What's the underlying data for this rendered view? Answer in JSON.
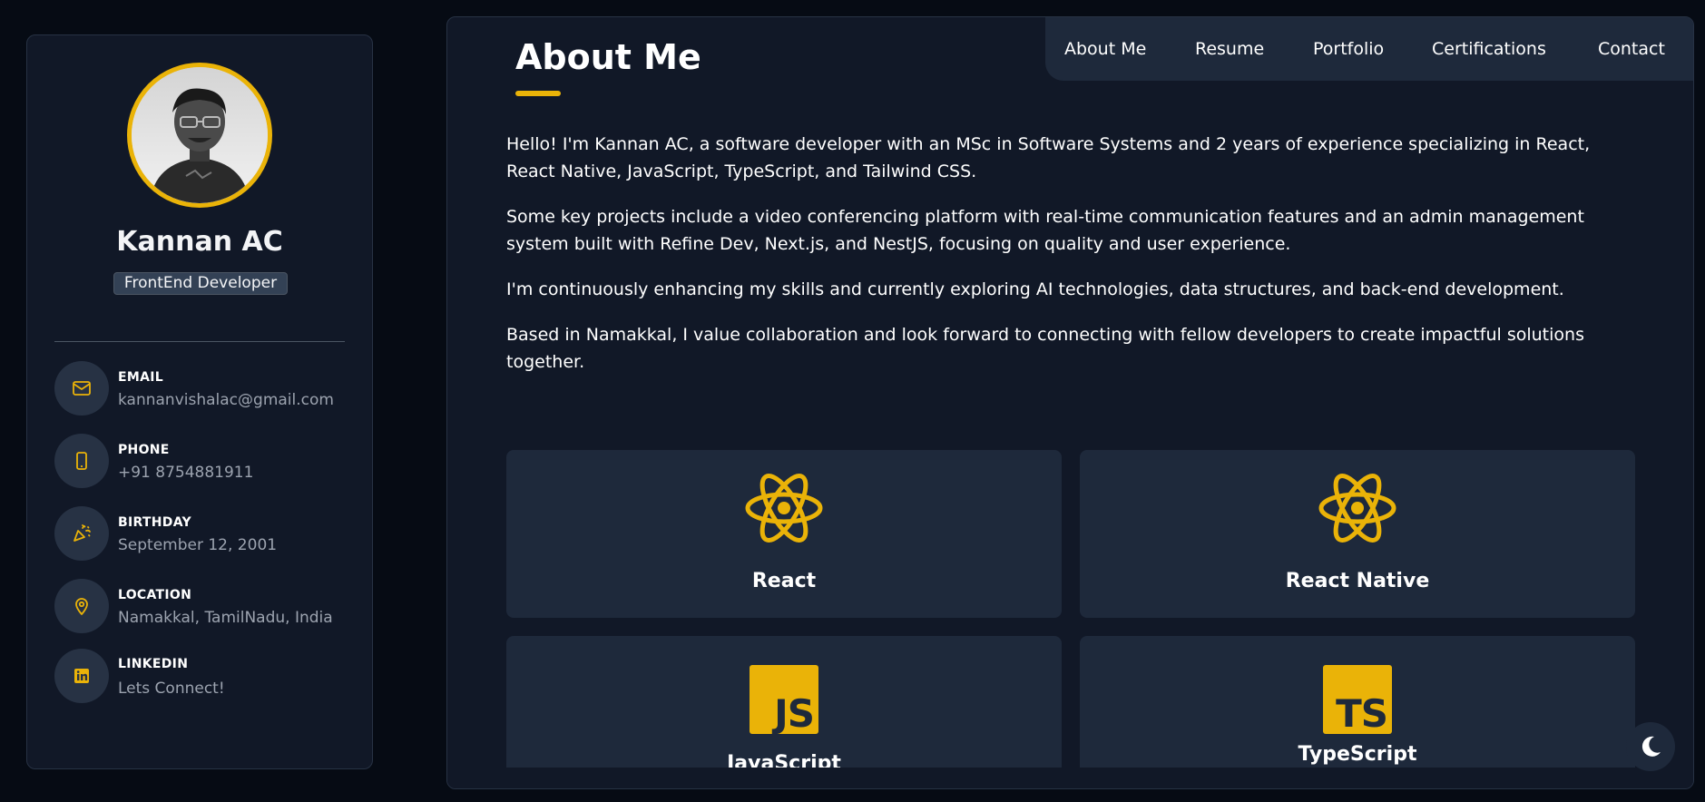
{
  "profile": {
    "name": "Kannan AC",
    "role": "FrontEnd Developer"
  },
  "contacts": [
    {
      "label": "EMAIL",
      "value": "kannanvishalac@gmail.com",
      "icon": "mail-icon"
    },
    {
      "label": "PHONE",
      "value": "+91 8754881911",
      "icon": "phone-icon"
    },
    {
      "label": "BIRTHDAY",
      "value": "September 12, 2001",
      "icon": "party-popper-icon"
    },
    {
      "label": "LOCATION",
      "value": "Namakkal, TamilNadu, India",
      "icon": "map-pin-icon"
    },
    {
      "label": "LINKEDIN",
      "value": "Lets Connect!",
      "icon": "linkedin-icon"
    }
  ],
  "nav": {
    "items": [
      "About Me",
      "Resume",
      "Portfolio",
      "Certifications",
      "Contact"
    ]
  },
  "about": {
    "title": "About Me",
    "paragraphs": [
      "Hello! I'm Kannan AC, a software developer with an MSc in Software Systems and 2 years of experience specializing in React, React Native, JavaScript, TypeScript, and Tailwind CSS.",
      "Some key projects include a video conferencing platform with real-time communication features and an admin management system built with Refine Dev, Next.js, and NestJS, focusing on quality and user experience.",
      "I'm continuously enhancing my skills and currently exploring AI technologies, data structures, and back-end development.",
      "Based in Namakkal, I value collaboration and look forward to connecting with fellow developers to create impactful solutions together."
    ]
  },
  "skills": [
    {
      "name": "React",
      "icon": "react-icon"
    },
    {
      "name": "React Native",
      "icon": "react-icon"
    },
    {
      "name": "JavaScript",
      "icon": "javascript-icon",
      "badge": "JS"
    },
    {
      "name": "TypeScript",
      "icon": "typescript-icon",
      "badge": "TS"
    }
  ],
  "theme_toggle": {
    "icon": "moon-icon"
  },
  "colors": {
    "accent": "#eab308",
    "page_bg": "#060b14",
    "panel_bg": "#111827",
    "card_bg": "#1e293b"
  }
}
